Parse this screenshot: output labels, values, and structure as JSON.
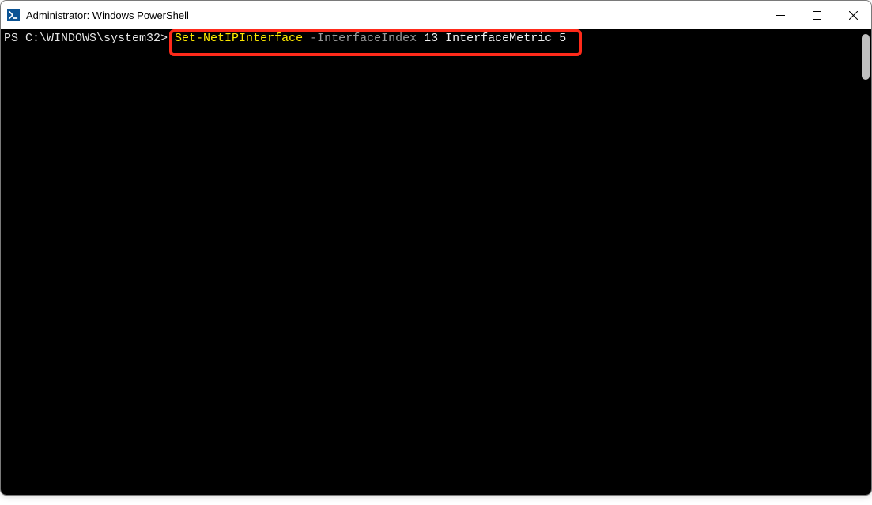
{
  "titlebar": {
    "title": "Administrator: Windows PowerShell"
  },
  "terminal": {
    "prompt": "PS C:\\WINDOWS\\system32> ",
    "command": "Set-NetIPInterface",
    "param": "-InterfaceIndex",
    "arg1": "13",
    "arg2_label": "InterfaceMetric",
    "arg2_value": "5"
  }
}
